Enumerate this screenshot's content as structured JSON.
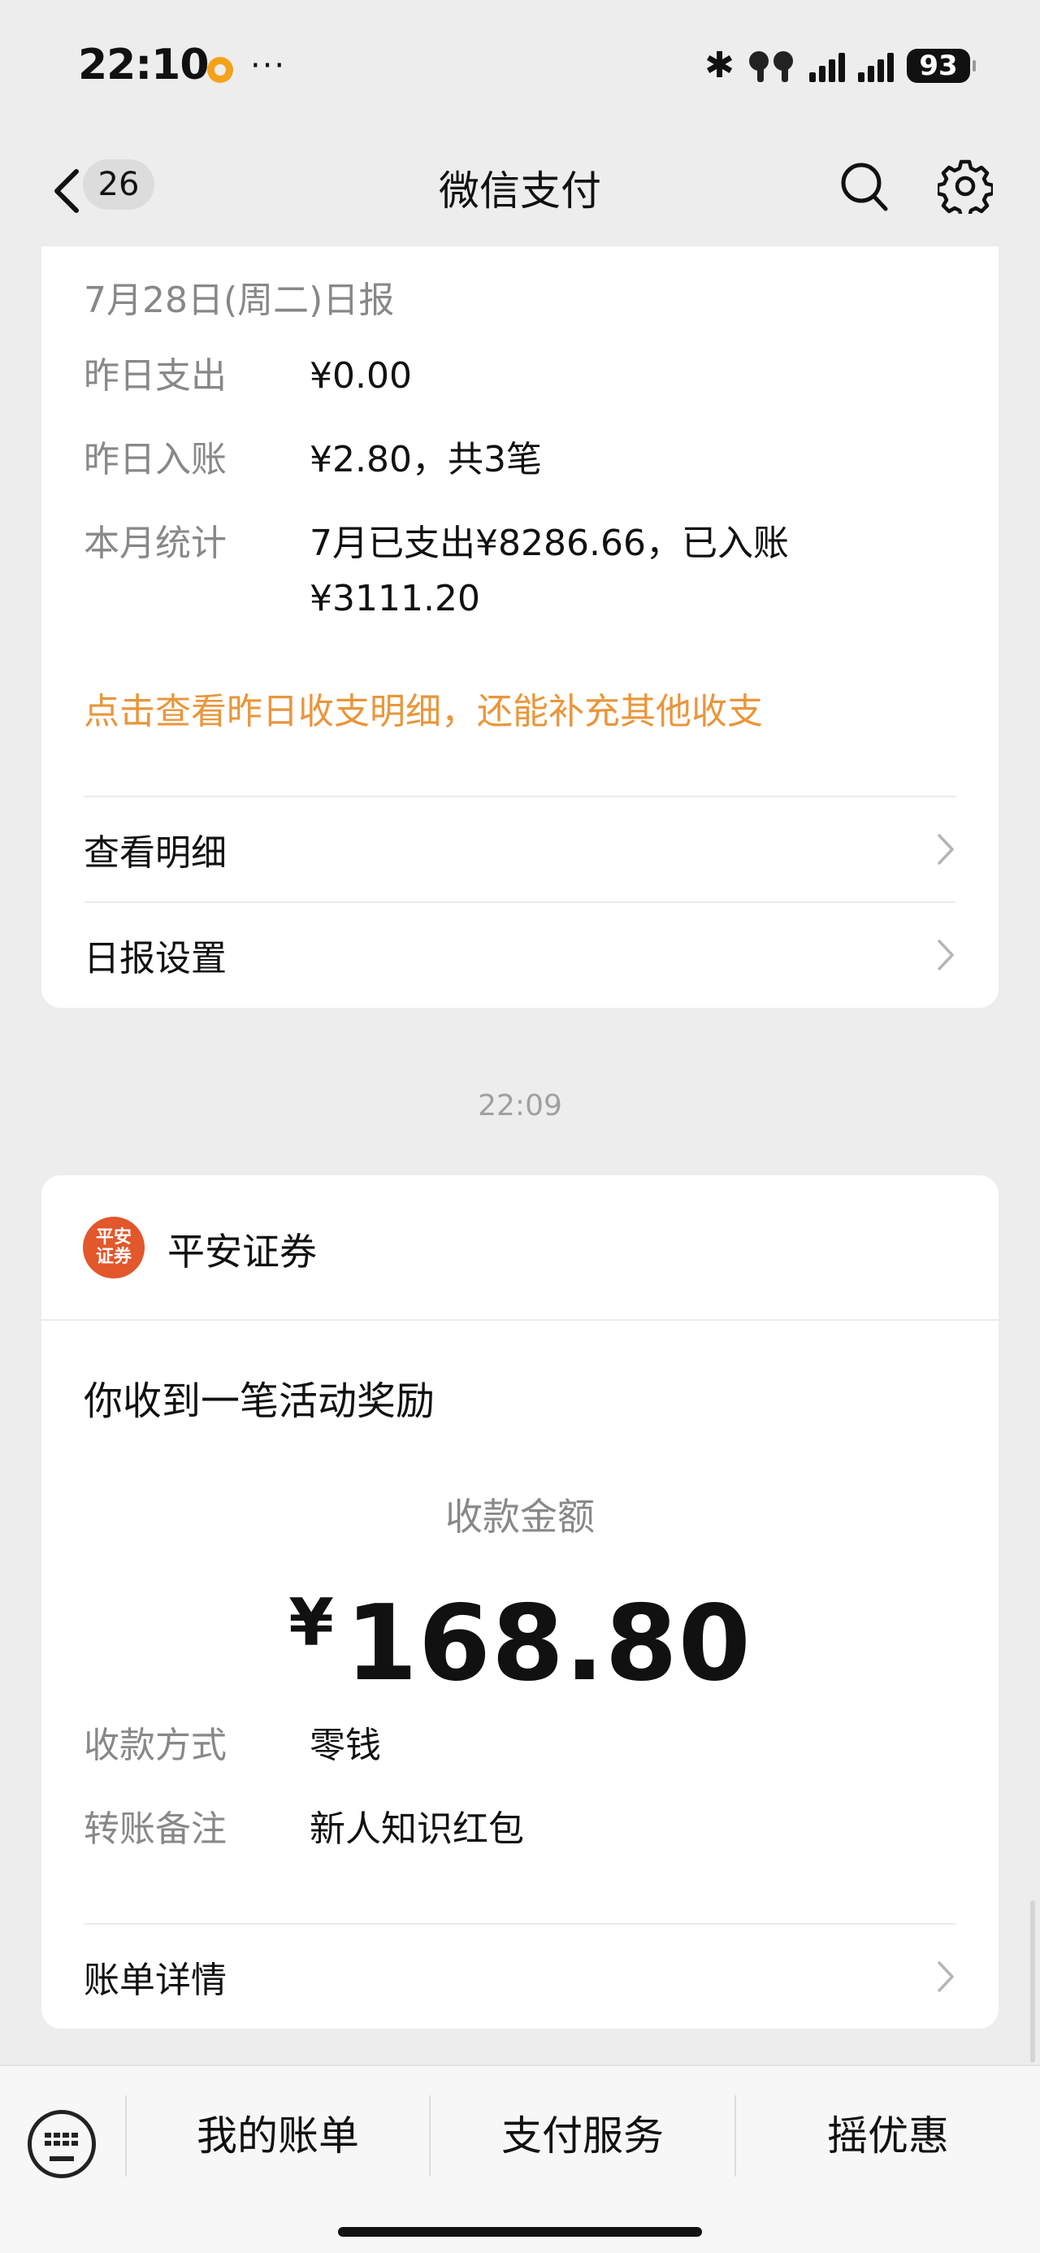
{
  "status_bar": {
    "time": "22:10",
    "notification_dots": "···",
    "battery": "93"
  },
  "nav": {
    "badge_count": "26",
    "title": "微信支付"
  },
  "daily_report": {
    "title": "7月28日(周二)日报",
    "rows": [
      {
        "label": "昨日支出",
        "value": "¥0.00"
      },
      {
        "label": "昨日入账",
        "value": "¥2.80，共3笔"
      },
      {
        "label": "本月统计",
        "value": "7月已支出¥8286.66，已入账¥3111.20"
      }
    ],
    "link_text": "点击查看昨日收支明细，还能补充其他收支",
    "link_color": "#e9963b",
    "menu": [
      {
        "label": "查看明细"
      },
      {
        "label": "日报设置"
      }
    ]
  },
  "timestamp": "22:09",
  "payment_notice": {
    "merchant_logo_text": "平安证券",
    "merchant_name": "平安证券",
    "logo_color": "#e2572b",
    "title": "你收到一笔活动奖励",
    "amount_label": "收款金额",
    "currency_symbol": "¥",
    "amount": "168.80",
    "rows": [
      {
        "label": "收款方式",
        "value": "零钱"
      },
      {
        "label": "转账备注",
        "value": "新人知识红包"
      }
    ],
    "detail_link": "账单详情"
  },
  "bottom_bar": {
    "tabs": [
      {
        "label": "我的账单"
      },
      {
        "label": "支付服务"
      },
      {
        "label": "摇优惠"
      }
    ]
  },
  "icons": {
    "back": "chevron-left-icon",
    "search": "search-icon",
    "settings": "gear-icon",
    "keyboard": "keyboard-icon",
    "chevron": "chevron-right-icon"
  }
}
